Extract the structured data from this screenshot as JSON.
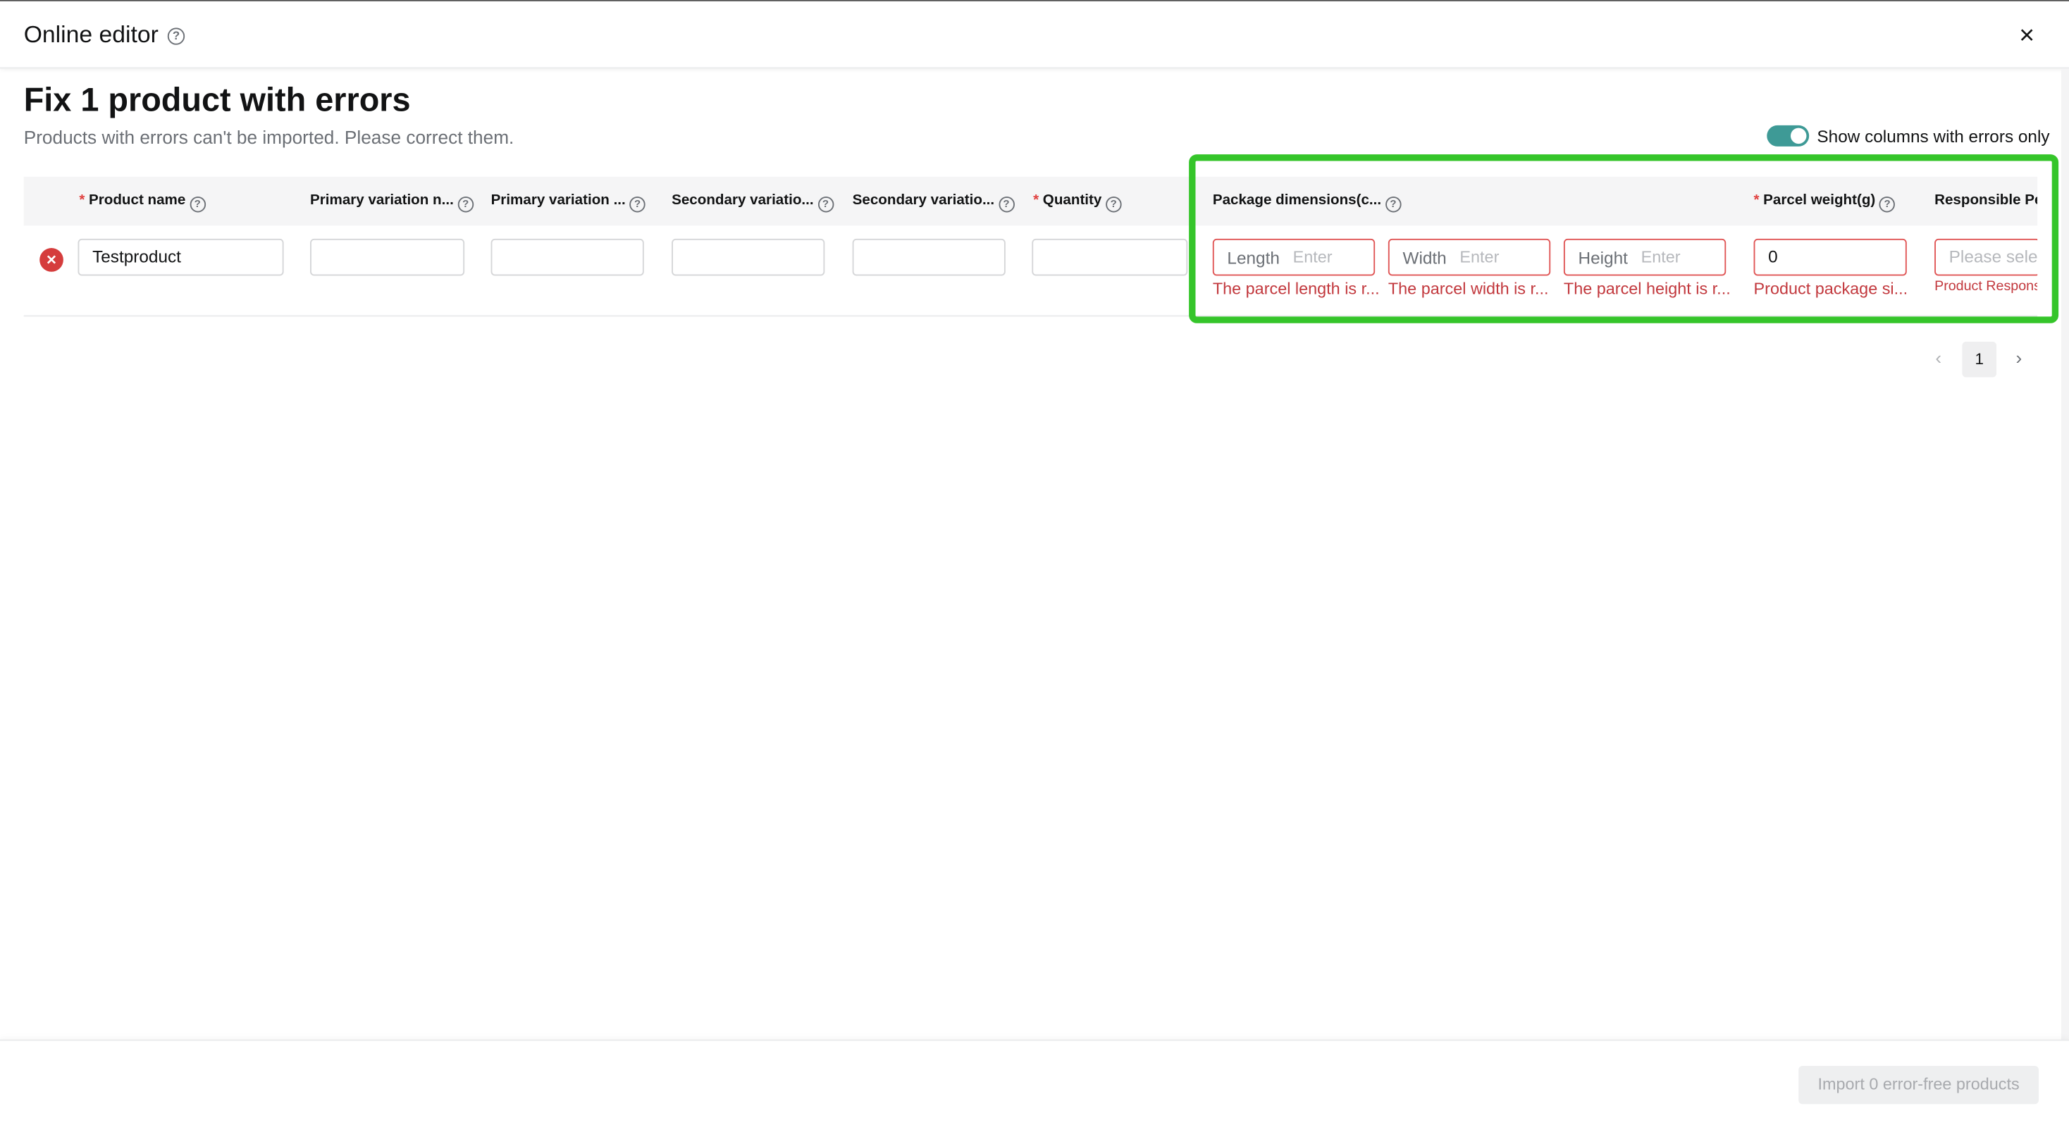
{
  "header": {
    "title": "Online editor",
    "help": "?",
    "close": "×"
  },
  "page": {
    "title": "Fix 1 product with errors",
    "subtitle": "Products with errors can't be imported. Please correct them."
  },
  "toggle": {
    "label": "Show columns with errors only",
    "on": true
  },
  "columns": [
    {
      "label": "Product name",
      "required": true
    },
    {
      "label": "Primary variation n...",
      "required": false
    },
    {
      "label": "Primary variation ...",
      "required": false
    },
    {
      "label": "Secondary variatio...",
      "required": false
    },
    {
      "label": "Secondary variatio...",
      "required": false
    },
    {
      "label": "Quantity",
      "required": true
    },
    {
      "label": "Package dimensions(c...",
      "required": false
    },
    {
      "label": "Parcel weight(g)",
      "required": true
    },
    {
      "label": "Responsible Per",
      "required": false
    }
  ],
  "row": {
    "error_icon": "×",
    "product_name": "Testproduct",
    "length": {
      "prefix": "Length",
      "placeholder": "Enter",
      "error": "The parcel length is r..."
    },
    "width": {
      "prefix": "Width",
      "placeholder": "Enter",
      "error": "The parcel width is r..."
    },
    "height": {
      "prefix": "Height",
      "placeholder": "Enter",
      "error": "The parcel height is r..."
    },
    "parcel_weight": {
      "value": "0",
      "error": "Product package si..."
    },
    "responsible": {
      "placeholder": "Please selec",
      "error": "Product Respons"
    }
  },
  "pagination": {
    "prev": "‹",
    "current": "1",
    "next": "›"
  },
  "footer": {
    "import_label": "Import 0 error-free products"
  },
  "colors": {
    "accent_toggle": "#3e9a96",
    "error": "#c2383d",
    "highlight": "#35c52a"
  }
}
